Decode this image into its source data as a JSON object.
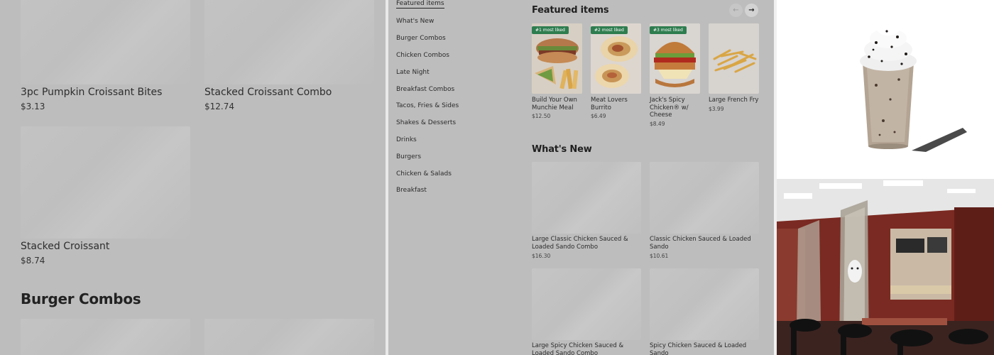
{
  "left_pane": {
    "items": [
      {
        "name": "3pc Pumpkin Croissant Bites",
        "price": "$3.13"
      },
      {
        "name": "Stacked Croissant Combo",
        "price": "$12.74"
      },
      {
        "name": "Stacked Croissant",
        "price": "$8.74"
      }
    ],
    "section_heading": "Burger Combos"
  },
  "category_nav": {
    "items": [
      "Featured items",
      "What's New",
      "Burger Combos",
      "Chicken Combos",
      "Late Night",
      "Breakfast Combos",
      "Tacos, Fries & Sides",
      "Shakes & Desserts",
      "Drinks",
      "Burgers",
      "Chicken & Salads",
      "Breakfast"
    ],
    "active": "Featured items"
  },
  "featured": {
    "title": "Featured items",
    "prev_arrow": "←",
    "next_arrow": "→",
    "items": [
      {
        "badge": "#1 most liked",
        "name": "Build Your Own Munchie Meal",
        "price": "$12.50"
      },
      {
        "badge": "#2 most liked",
        "name": "Meat Lovers Burrito",
        "price": "$6.49"
      },
      {
        "badge": "#3 most liked",
        "name": "Jack's Spicy Chicken® w/ Cheese",
        "price": "$8.49"
      },
      {
        "badge": "",
        "name": "Large French Fry",
        "price": "$3.99"
      }
    ]
  },
  "whats_new": {
    "title": "What's New",
    "items": [
      {
        "name": "Large Classic Chicken Sauced & Loaded Sando Combo",
        "price": "$16.30"
      },
      {
        "name": "Classic Chicken Sauced & Loaded Sando",
        "price": "$10.61"
      },
      {
        "name": "Large Spicy Chicken Sauced & Loaded Sando Combo",
        "price": ""
      },
      {
        "name": "Spicy Chicken Sauced & Loaded Sando",
        "price": ""
      }
    ]
  },
  "colors": {
    "badge_green": "#2e7d4f",
    "overlay_gray": "#bdbdbd",
    "restaurant_wall": "#7a2a22"
  }
}
